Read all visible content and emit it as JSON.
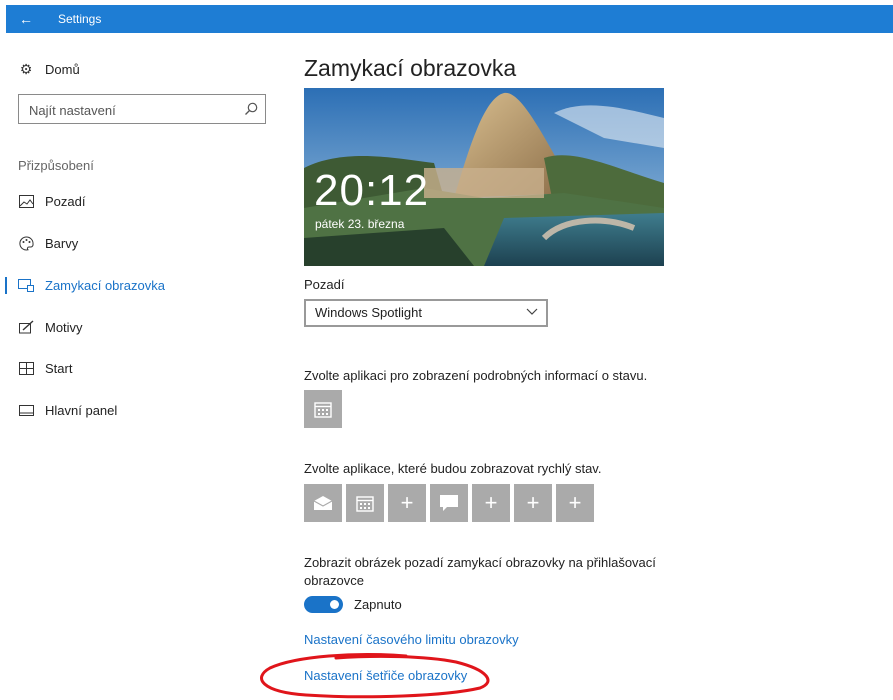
{
  "window": {
    "title": "Settings"
  },
  "sidebar": {
    "home": "Domů",
    "search_placeholder": "Najít nastavení",
    "section": "Přizpůsobení",
    "items": [
      {
        "label": "Pozadí",
        "icon": "picture-icon"
      },
      {
        "label": "Barvy",
        "icon": "palette-icon"
      },
      {
        "label": "Zamykací obrazovka",
        "icon": "lock-screen-icon",
        "active": true
      },
      {
        "label": "Motivy",
        "icon": "themes-icon"
      },
      {
        "label": "Start",
        "icon": "start-icon"
      },
      {
        "label": "Hlavní panel",
        "icon": "taskbar-icon"
      }
    ]
  },
  "main": {
    "title": "Zamykací obrazovka",
    "preview": {
      "time": "20:12",
      "date": "pátek 23. března"
    },
    "background_label": "Pozadí",
    "background_value": "Windows Spotlight",
    "detailed_status_label": "Zvolte aplikaci pro zobrazení podrobných informací o stavu.",
    "quick_status_label": "Zvolte aplikace, které budou zobrazovat rychlý stav.",
    "quick_tiles": [
      "mail-icon",
      "calendar-icon",
      "plus-icon",
      "message-icon",
      "plus-icon",
      "plus-icon",
      "plus-icon"
    ],
    "signin_label_line1": "Zobrazit obrázek pozadí zamykací obrazovky na přihlašovací",
    "signin_label_line2": "obrazovce",
    "toggle_state": "Zapnuto",
    "toggle_on": true,
    "link_timeout": "Nastavení časového limitu obrazovky",
    "link_screensaver": "Nastavení šetřiče obrazovky"
  },
  "colors": {
    "accent": "#1a73c8",
    "titlebar": "#1e7dd4",
    "tile": "#aaaaaa",
    "annotation": "#e0151b"
  }
}
